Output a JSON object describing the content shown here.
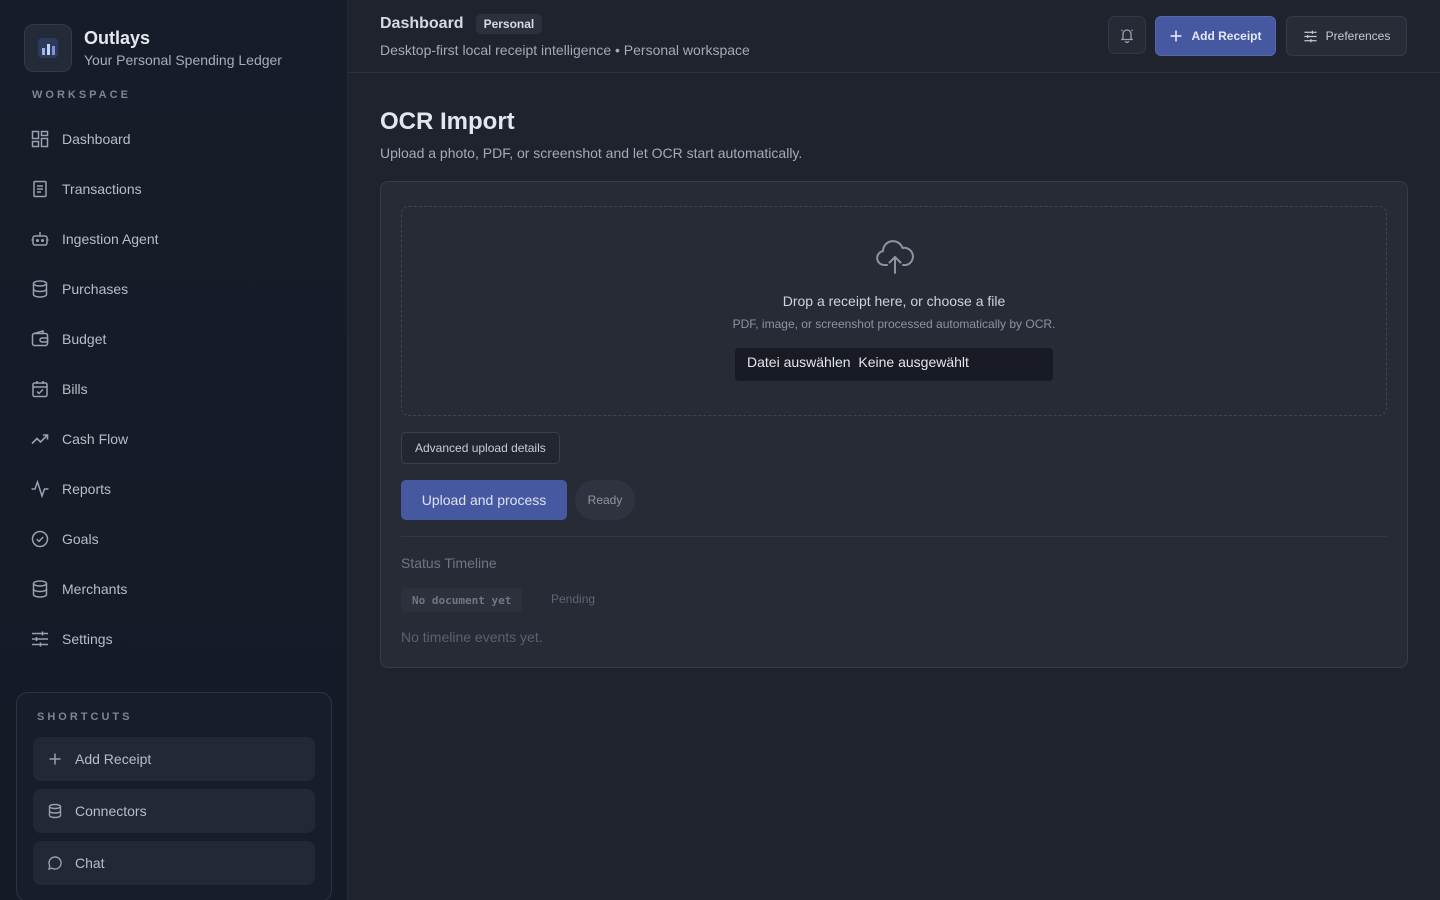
{
  "brand": {
    "name": "Outlays",
    "subtitle": "Your Personal Spending Ledger"
  },
  "sidebar": {
    "section_label": "WORKSPACE",
    "items": [
      {
        "label": "Dashboard",
        "icon": "dashboard-grid-icon"
      },
      {
        "label": "Transactions",
        "icon": "receipt-list-icon"
      },
      {
        "label": "Ingestion Agent",
        "icon": "robot-icon"
      },
      {
        "label": "Purchases",
        "icon": "database-stack-icon"
      },
      {
        "label": "Budget",
        "icon": "wallet-icon"
      },
      {
        "label": "Bills",
        "icon": "calendar-check-icon"
      },
      {
        "label": "Cash Flow",
        "icon": "trending-up-icon"
      },
      {
        "label": "Reports",
        "icon": "activity-pulse-icon"
      },
      {
        "label": "Goals",
        "icon": "check-circle-icon"
      },
      {
        "label": "Merchants",
        "icon": "database-stack-icon"
      },
      {
        "label": "Settings",
        "icon": "sliders-icon"
      }
    ]
  },
  "shortcuts": {
    "label": "SHORTCUTS",
    "items": [
      {
        "label": "Add Receipt",
        "icon": "plus-icon"
      },
      {
        "label": "Connectors",
        "icon": "database-stack-icon"
      },
      {
        "label": "Chat",
        "icon": "chat-bubble-icon"
      }
    ]
  },
  "header": {
    "title": "Dashboard",
    "badge": "Personal",
    "subtitle": "Desktop-first local receipt intelligence • Personal workspace",
    "add_receipt_label": "Add Receipt",
    "preferences_label": "Preferences"
  },
  "main": {
    "title": "OCR Import",
    "subtitle": "Upload a photo, PDF, or screenshot and let OCR start automatically.",
    "dropzone": {
      "title": "Drop a receipt here, or choose a file",
      "subtitle": "PDF, image, or screenshot processed automatically by OCR.",
      "file_button": "Datei auswählen",
      "file_status": "Keine ausgewählt"
    },
    "advanced_label": "Advanced upload details",
    "process_label": "Upload and process",
    "ready_label": "Ready",
    "timeline": {
      "title": "Status Timeline",
      "document": "No document yet",
      "status": "Pending",
      "empty": "No timeline events yet."
    }
  },
  "colors": {
    "accent": "#4558a0",
    "background": "#1f232d",
    "sidebar": "#161c29",
    "card": "#272b36"
  }
}
